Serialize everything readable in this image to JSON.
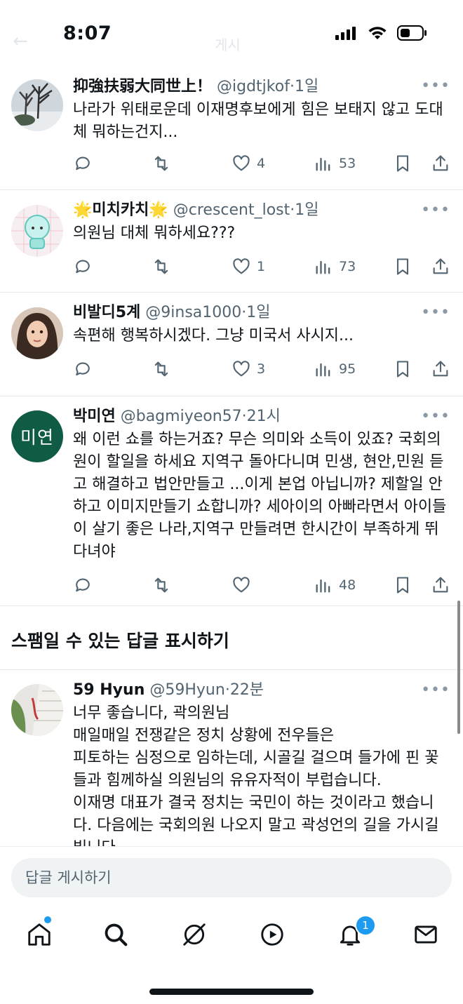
{
  "status_bar": {
    "time": "8:07"
  },
  "header": {
    "title": "게시"
  },
  "replies": [
    {
      "author": "抑強扶弱大同世上！",
      "handle": "@igdtjkof",
      "separator": "·",
      "time": "1일",
      "text": "나라가 위태로운데 이재명후보에게 힘은 보태지 않고 도대체 뭐하는건지...",
      "likes": "4",
      "views": "53"
    },
    {
      "author": "🌟미치카치🌟",
      "handle": "@crescent_lost",
      "separator": "·",
      "time": "1일",
      "text": "의원님 대체 뭐하세요???",
      "likes": "1",
      "views": "73"
    },
    {
      "author": "비발디5계",
      "handle": "@9insa1000",
      "separator": "·",
      "time": "1일",
      "text": "속편해 행복하시겠다. 그냥 미국서 사시지...",
      "likes": "3",
      "views": "95"
    },
    {
      "author": "박미연",
      "handle": "@bagmiyeon57",
      "separator": "·",
      "time": "21시",
      "avatar_text": "미연",
      "text": "왜 이런 쇼를 하는거죠? 무슨 의미와 소득이 있죠? 국회의원이 할일을 하세요 지역구 돌아다니며 민생, 현안,민원 듣고 해결하고 법안만들고 ...이게 본업 아닙니까?  제할일 안하고 이미지만들기 쇼합니까? 세아이의 아빠라면서 아이들이 살기 좋은 나라,지역구 만들려면 한시간이 부족하게 뛰다녀야",
      "likes": "",
      "views": "48"
    },
    {
      "author": "59 Hyun",
      "handle": "@59Hyun",
      "separator": "·",
      "time": "22분",
      "text": "너무 좋습니다, 곽의원님\n매일매일 전쟁같은 정치 상황에 전우들은\n피토하는 심정으로 임하는데, 시골길 걸으며 들가에 핀 꽃들과 힘께하실 의원님의 유유자적이 부럽습니다.\n이재명 대표가 결국 정치는 국민이 하는 것이라고 했습니다. 다음에는 국회의원 나오지 말고 곽성언의 길을 가시길 빕니다."
    }
  ],
  "spam_section": {
    "label": "스팸일 수 있는 답글 표시하기"
  },
  "reply_bar": {
    "placeholder": "답글 게시하기"
  },
  "tab_bar": {
    "tabs": [
      "home-icon",
      "search-icon",
      "grok-icon",
      "video-icon",
      "bell-icon",
      "mail-icon"
    ],
    "notification_count": "1"
  },
  "colors": {
    "accent": "#1d9bf0",
    "secondary_text": "#536471",
    "avatar_green": "#0f5b45"
  }
}
